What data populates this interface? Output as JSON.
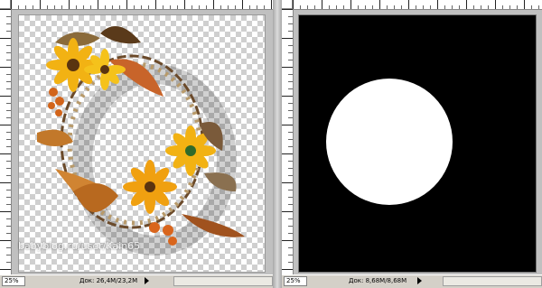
{
  "left_window": {
    "zoom": "25%",
    "doc_info": "Док: 26,4M/23,2M"
  },
  "right_window": {
    "zoom": "25%",
    "doc_info": "Док: 8,68M/8,68M"
  },
  "watermark": "babyblog.ru/user/Kain65",
  "colors": {
    "chrome": "#d4d0c8",
    "mask_background": "#000000",
    "mask_circle": "#ffffff"
  }
}
